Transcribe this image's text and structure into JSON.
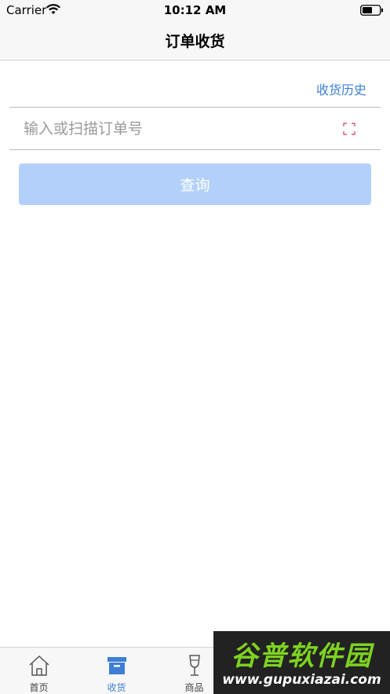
{
  "status_bar": {
    "carrier": "Carrier",
    "time": "10:12 AM"
  },
  "nav": {
    "title": "订单收货"
  },
  "receive": {
    "history_link": "收货历史",
    "order_input": {
      "value": "",
      "placeholder": "输入或扫描订单号"
    },
    "query_button": "查询"
  },
  "tabs": [
    {
      "label": "首页",
      "icon": "home-icon",
      "active": false
    },
    {
      "label": "收货",
      "icon": "box-icon",
      "active": true
    },
    {
      "label": "商品",
      "icon": "wine-glass-icon",
      "active": false
    }
  ],
  "watermark": {
    "title": "谷普软件园",
    "url": "www.gupuxiazai.com"
  },
  "colors": {
    "accent": "#3d7fd6",
    "button_disabled": "#b3d0fb",
    "scan_icon": "#e0567a"
  }
}
